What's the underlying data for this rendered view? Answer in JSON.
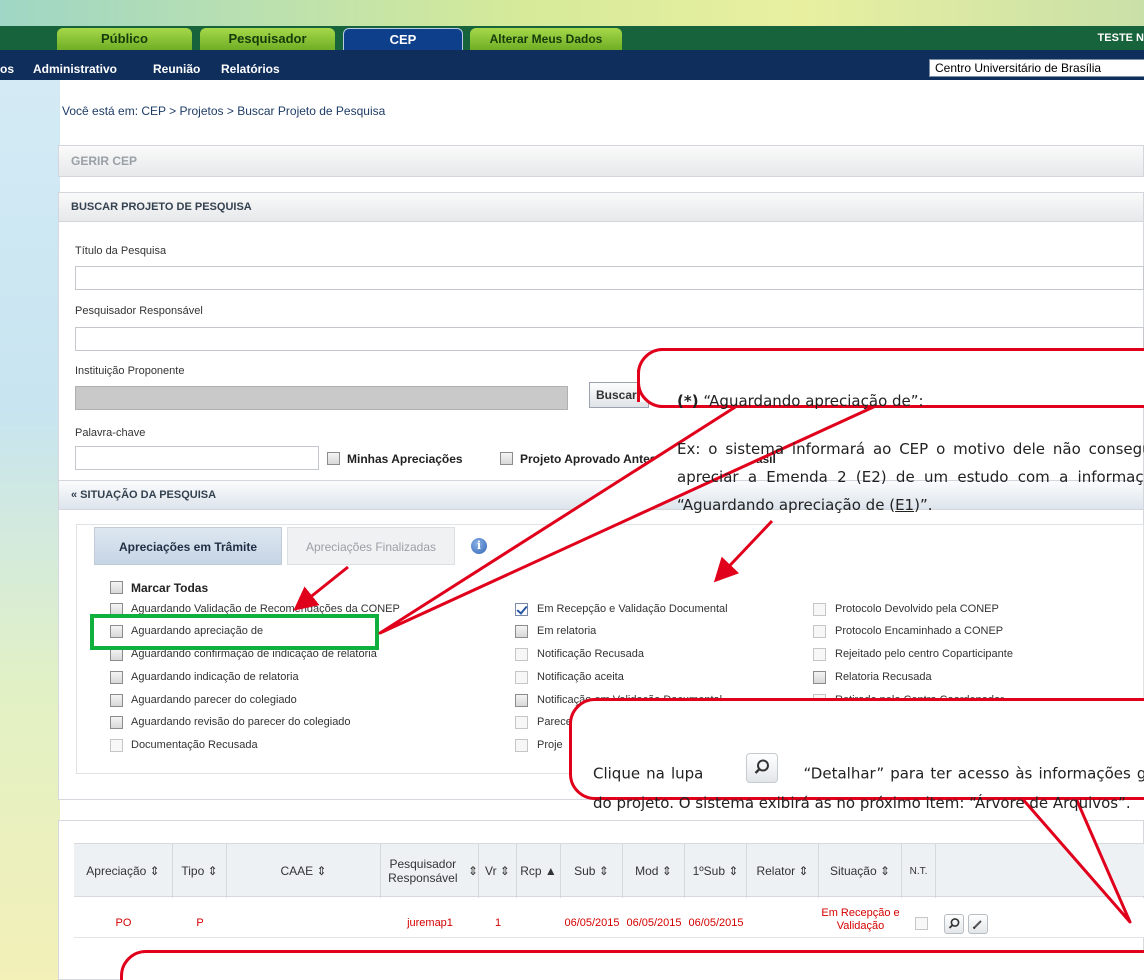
{
  "header": {
    "tabs": [
      {
        "label": "Público"
      },
      {
        "label": "Pesquisador"
      },
      {
        "label": "CEP"
      },
      {
        "label": "Alterar Meus Dados"
      }
    ],
    "user": "TESTE N",
    "menu": [
      {
        "label": "os"
      },
      {
        "label": "Administrativo"
      },
      {
        "label": "Reunião"
      },
      {
        "label": "Relatórios"
      }
    ],
    "institution": "Centro Universitário de Brasília"
  },
  "breadcrumb": "Você está em: CEP > Projetos > Buscar Projeto de Pesquisa",
  "gerir_title": "GERIR CEP",
  "search": {
    "title": "BUSCAR PROJETO DE PESQUISA",
    "titulo_label": "Título da Pesquisa",
    "titulo_value": "",
    "pesquisador_label": "Pesquisador Responsável",
    "pesquisador_value": "",
    "instituicao_label": "Instituição Proponente",
    "instituicao_value": "",
    "buscar_inst_button": "Buscar Instituição",
    "palavra_label": "Palavra-chave",
    "palavra_value": "",
    "minhas_apreciacoes": "Minhas Apreciações",
    "projeto_aprovado": "Projeto Aprovado Antes da Plataforma Brasil"
  },
  "situacao": {
    "title": "« SITUAÇÃO DA PESQUISA",
    "tab_active": "Apreciações em Trâmite",
    "tab_inactive": "Apreciações Finalizadas",
    "info_glyph": "i",
    "marcar_todas": "Marcar Todas",
    "col1": [
      {
        "label": "Aguardando Validação de Recomendações da CONEP",
        "checked": false
      },
      {
        "label": "Aguardando apreciação de",
        "checked": false
      },
      {
        "label": "Aguardando confirmação de indicação de relatoria",
        "checked": false
      },
      {
        "label": "Aguardando indicação de relatoria",
        "checked": false
      },
      {
        "label": "Aguardando parecer do colegiado",
        "checked": false
      },
      {
        "label": "Aguardando revisão do parecer do colegiado",
        "checked": false
      },
      {
        "label": "Documentação Recusada",
        "checked": false
      }
    ],
    "col2": [
      {
        "label": "Em Recepção e Validação Documental",
        "checked": true
      },
      {
        "label": "Em relatoria",
        "checked": false
      },
      {
        "label": "Notificação Recusada",
        "checked": false
      },
      {
        "label": "Notificação aceita",
        "checked": false
      },
      {
        "label": "Notificação em Validação Documental",
        "checked": false
      },
      {
        "label": "Parecer",
        "checked": false
      },
      {
        "label": "Proje",
        "checked": false
      }
    ],
    "col3": [
      {
        "label": "Protocolo Devolvido pela CONEP",
        "checked": false
      },
      {
        "label": "Protocolo Encaminhado a CONEP",
        "checked": false
      },
      {
        "label": "Rejeitado pelo centro Coparticipante",
        "checked": false
      },
      {
        "label": "Relatoria Recusada",
        "checked": false
      },
      {
        "label": "Retirado pelo Centro Coordenador",
        "checked": false
      }
    ]
  },
  "table": {
    "headers": [
      {
        "label": "Apreciação",
        "sort": "⇕"
      },
      {
        "label": "Tipo",
        "sort": "⇕"
      },
      {
        "label": "CAAE",
        "sort": "⇕"
      },
      {
        "label": "Pesquisador Responsável",
        "sort": "⇕"
      },
      {
        "label": "Vr",
        "sort": "⇕"
      },
      {
        "label": "Rcp",
        "sort": "▲"
      },
      {
        "label": "Sub",
        "sort": "⇕"
      },
      {
        "label": "Mod",
        "sort": "⇕"
      },
      {
        "label": "1ºSub",
        "sort": "⇕"
      },
      {
        "label": "Relator",
        "sort": "⇕"
      },
      {
        "label": "Situação",
        "sort": "⇕"
      },
      {
        "label": "N.T.",
        "sort": ""
      }
    ],
    "row": {
      "apreciacao": "PO",
      "tipo": "P",
      "caae": "",
      "pesquisador": "juremap1",
      "vr": "1",
      "rcp": "",
      "sub": "06/05/2015",
      "mod": "06/05/2015",
      "primeiro_sub": "06/05/2015",
      "relator": "",
      "situacao": "Em Recepção e Validação",
      "nt_checked": false
    }
  },
  "callout_top": {
    "heading_bold": "(*)",
    "heading_rest": " “Aguardando apreciação de”:",
    "body_before": "Ex: o sistema informará ao CEP o motivo dele não conseguir apreciar a Emenda 2 (E2) de um estudo com a informação “Aguardando apreciação de (",
    "body_link": "E1",
    "body_after": ")”."
  },
  "callout_bottom": {
    "text_before": "Clique na lupa",
    "text_after": "“Detalhar” para ter acesso às informações gerais do projeto. O sistema exibirá as no próximo item: “Árvore de Arquivos”."
  },
  "colors": {
    "nav_green": "#17633b",
    "menu_blue": "#0f2e5c",
    "callout_red": "#e0001b",
    "highlight_green": "#10b03e",
    "row_red": "#d40000"
  }
}
